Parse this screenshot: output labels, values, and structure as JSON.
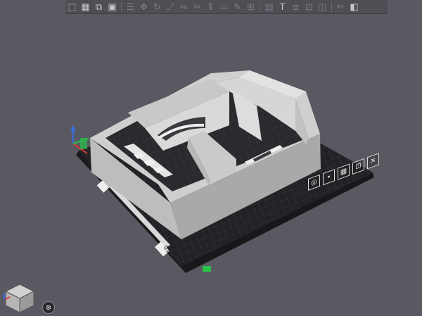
{
  "toolbar": {
    "buttons": [
      {
        "icon": "add-shape-icon",
        "glyph": "⬚",
        "enabled": true
      },
      {
        "icon": "grid-icon",
        "glyph": "▦",
        "enabled": true
      },
      {
        "icon": "open-file-icon",
        "glyph": "⧉",
        "enabled": true
      },
      {
        "icon": "save-icon",
        "glyph": "▣",
        "enabled": true
      },
      {
        "icon": "list-icon",
        "glyph": "☰",
        "enabled": false
      },
      {
        "icon": "move-icon",
        "glyph": "✥",
        "enabled": false
      },
      {
        "icon": "rotate-icon",
        "glyph": "↻",
        "enabled": false
      },
      {
        "icon": "scale-icon",
        "glyph": "⤢",
        "enabled": false
      },
      {
        "icon": "mirror-icon",
        "glyph": "⇋",
        "enabled": false
      },
      {
        "icon": "cut-icon",
        "glyph": "✂",
        "enabled": false
      },
      {
        "icon": "support-icon",
        "glyph": "⫴",
        "enabled": false
      },
      {
        "icon": "seam-icon",
        "glyph": "▭",
        "enabled": false
      },
      {
        "icon": "paint-icon",
        "glyph": "✎",
        "enabled": false
      },
      {
        "icon": "measure-icon",
        "glyph": "⊞",
        "enabled": false
      },
      {
        "icon": "layer-icon",
        "glyph": "▤",
        "enabled": false
      },
      {
        "icon": "text-tool-icon",
        "glyph": "T",
        "enabled": true
      },
      {
        "icon": "assembly-icon",
        "glyph": "⧈",
        "enabled": false
      },
      {
        "icon": "arrange-icon",
        "glyph": "⊡",
        "enabled": false
      },
      {
        "icon": "split-icon",
        "glyph": "◫",
        "enabled": false
      },
      {
        "icon": "pen-icon",
        "glyph": "✏",
        "enabled": false
      },
      {
        "icon": "view-icon",
        "glyph": "◧",
        "enabled": true
      }
    ]
  },
  "plate": {
    "label": "01",
    "side_labels": [
      "01",
      "01"
    ]
  },
  "plate_tools": [
    {
      "icon": "settings-icon",
      "glyph": "◎"
    },
    {
      "icon": "lock-icon",
      "glyph": "▪"
    },
    {
      "icon": "arrange-plate-icon",
      "glyph": "▦"
    },
    {
      "icon": "orient-icon",
      "glyph": "⊡"
    },
    {
      "icon": "close-plate-icon",
      "glyph": "✕"
    }
  ],
  "colors": {
    "background": "#595961",
    "plate": "#222226",
    "model": "#c9c9c9",
    "axis_x": "#d23a3a",
    "axis_y": "#28c248",
    "axis_z": "#3a6de0"
  }
}
